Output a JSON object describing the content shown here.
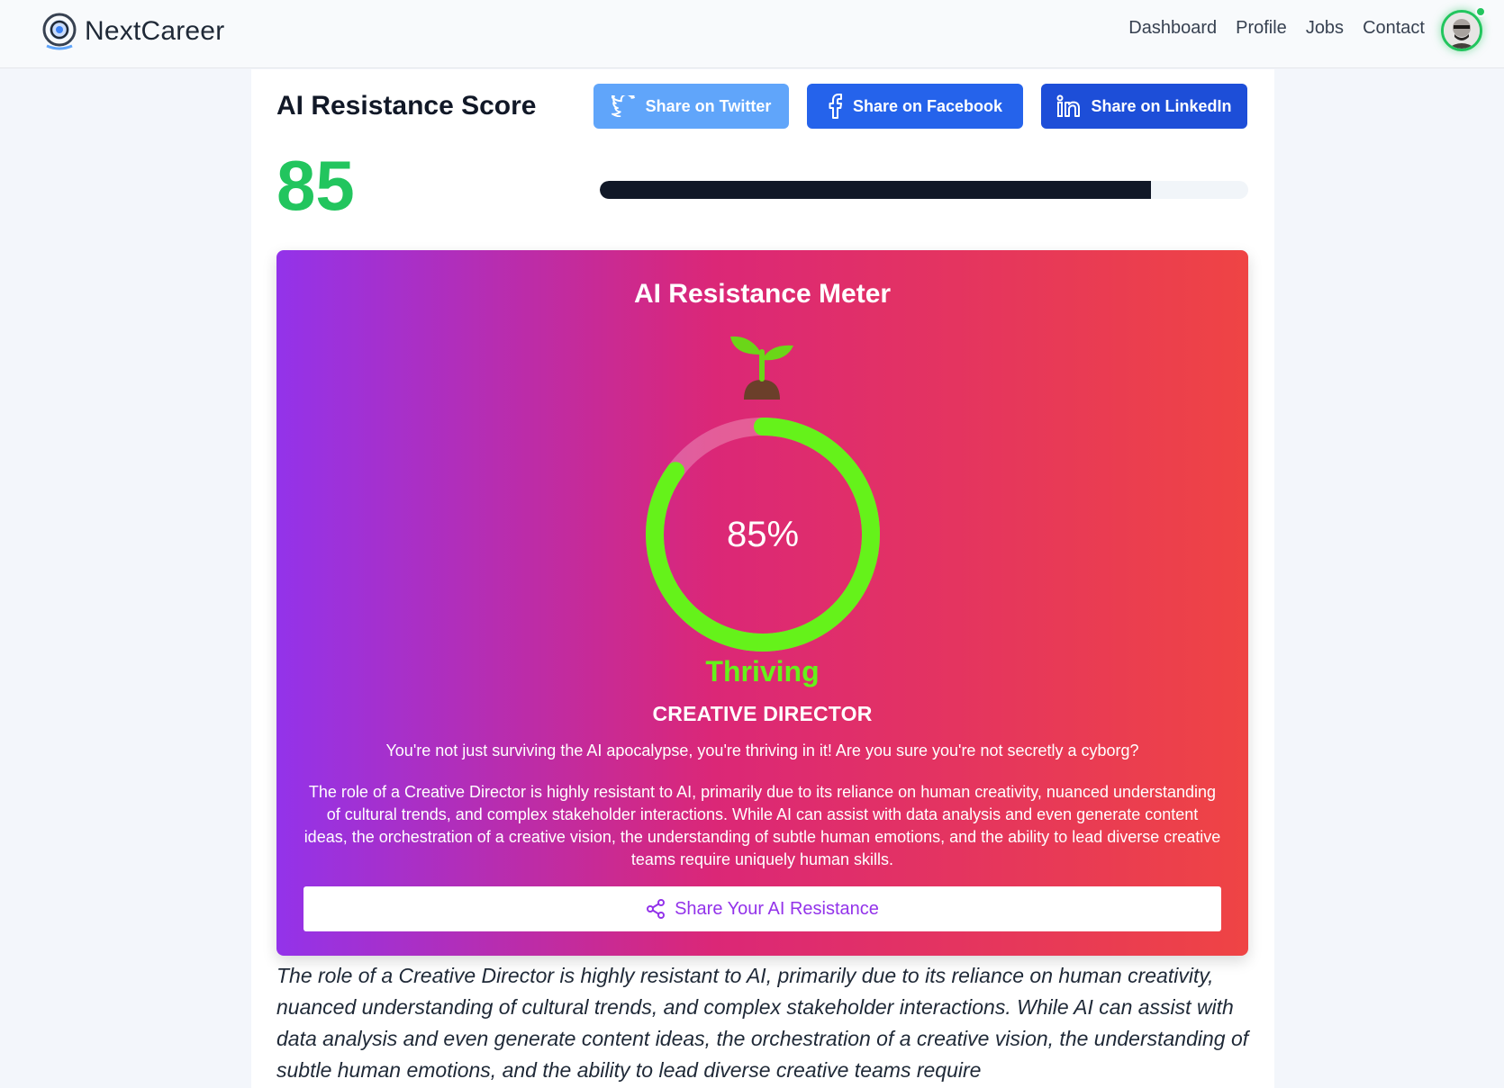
{
  "header": {
    "brand_name": "NextCareer",
    "nav": [
      "Dashboard",
      "Profile",
      "Jobs",
      "Contact"
    ]
  },
  "score": {
    "title": "AI Resistance Score",
    "value": "85",
    "progress_fraction": 0.85,
    "share_twitter": "Share on Twitter",
    "share_facebook": "Share on Facebook",
    "share_linkedin": "Share on LinkedIn"
  },
  "meter": {
    "title": "AI Resistance Meter",
    "percent_label": "85%",
    "percent_value": 85,
    "status": "Thriving",
    "job_title": "CREATIVE DIRECTOR",
    "quip": "You're not just surviving the AI apocalypse, you're thriving in it! Are you sure you're not secretly a cyborg?",
    "description": "The role of a Creative Director is highly resistant to AI, primarily due to its reliance on human creativity, nuanced understanding of cultural trends, and complex stakeholder interactions. While AI can assist with data analysis and even generate content ideas, the orchestration of a creative vision, the understanding of subtle human emotions, and the ability to lead diverse creative teams require uniquely human skills.",
    "share_button": "Share Your AI Resistance"
  },
  "body_text": "The role of a Creative Director is highly resistant to AI, primarily due to its reliance on human creativity, nuanced understanding of cultural trends, and complex stakeholder interactions. While AI can assist with data analysis and even generate content ideas, the orchestration of a creative vision, the understanding of subtle human emotions, and the ability to lead diverse creative teams require",
  "colors": {
    "score_green": "#22c55e",
    "ring_green": "#65f21a",
    "twitter": "#60a5fa",
    "facebook": "#2563eb",
    "linkedin": "#1d4ed8",
    "gradient_start": "#9333ea",
    "gradient_end": "#ef4444"
  },
  "icons": {
    "logo": "nextcareer-logo-icon",
    "twitter": "twitter-icon",
    "facebook": "facebook-icon",
    "linkedin": "linkedin-icon",
    "sprout": "sprout-icon",
    "share": "share-icon",
    "avatar": "user-avatar"
  }
}
